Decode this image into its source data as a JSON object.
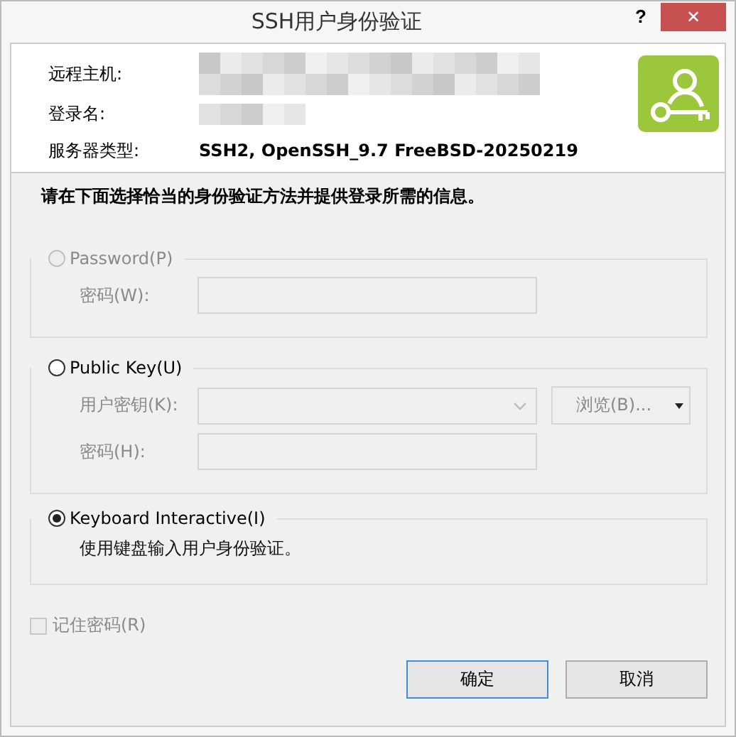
{
  "window": {
    "title": "SSH用户身份验证",
    "help": "?",
    "close": "✕"
  },
  "info": [
    {
      "label": "远程主机:",
      "redacted": true
    },
    {
      "label": "登录名:",
      "redacted": true
    },
    {
      "label": "服务器类型:",
      "value": "SSH2, OpenSSH_9.7 FreeBSD-20250219"
    }
  ],
  "instruction": "请在下面选择恰当的身份验证方法并提供登录所需的信息。",
  "methods": [
    {
      "kind": "password",
      "label": "Password(P)",
      "selected": false,
      "disabled": true,
      "fields": [
        {
          "kind": "text",
          "label": "密码(W):",
          "disabled": true
        }
      ]
    },
    {
      "kind": "publickey",
      "label": "Public Key(U)",
      "selected": false,
      "disabled": false,
      "fields": [
        {
          "kind": "select",
          "label": "用户密钥(K):",
          "disabled": true,
          "button": "浏览(B)..."
        },
        {
          "kind": "text",
          "label": "密码(H):",
          "disabled": true
        }
      ]
    },
    {
      "kind": "keyboard",
      "label": "Keyboard Interactive(I)",
      "selected": true,
      "disabled": false,
      "description": "使用键盘输入用户身份验证。"
    }
  ],
  "remember": {
    "label": "记住密码(R)",
    "checked": false,
    "disabled": true
  },
  "buttons": [
    {
      "label": "确定",
      "default": true
    },
    {
      "label": "取消",
      "default": false
    }
  ]
}
